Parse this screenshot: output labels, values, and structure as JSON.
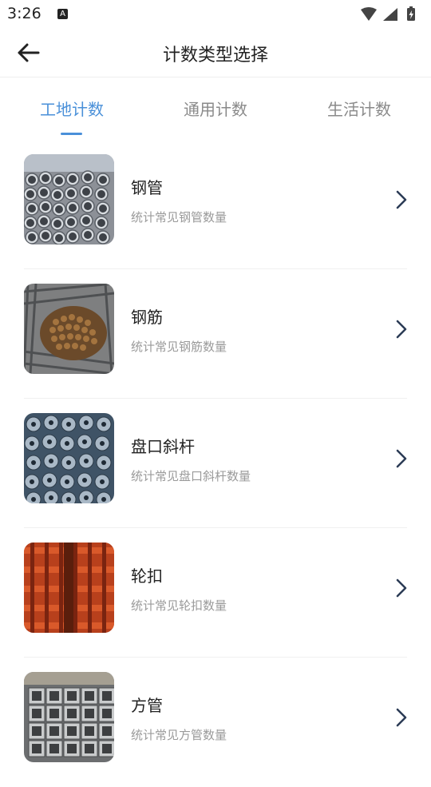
{
  "status": {
    "time": "3:26",
    "notif_icon": "A"
  },
  "header": {
    "title": "计数类型选择"
  },
  "tabs": [
    {
      "label": "工地计数",
      "active": true
    },
    {
      "label": "通用计数",
      "active": false
    },
    {
      "label": "生活计数",
      "active": false
    }
  ],
  "items": [
    {
      "title": "钢管",
      "subtitle": "统计常见钢管数量"
    },
    {
      "title": "钢筋",
      "subtitle": "统计常见钢筋数量"
    },
    {
      "title": "盘口斜杆",
      "subtitle": "统计常见盘口斜杆数量"
    },
    {
      "title": "轮扣",
      "subtitle": "统计常见轮扣数量"
    },
    {
      "title": "方管",
      "subtitle": "统计常见方管数量"
    }
  ],
  "colors": {
    "accent": "#4a90d9"
  }
}
